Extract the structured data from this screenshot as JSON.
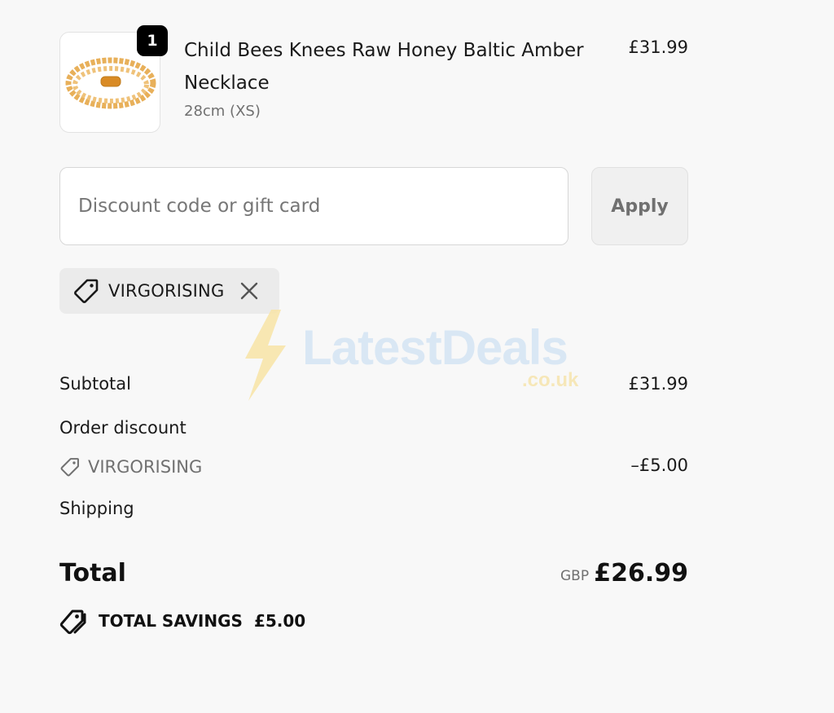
{
  "product": {
    "quantity": "1",
    "name": "Child Bees Knees Raw Honey Baltic Amber Necklace",
    "variant": "28cm (XS)",
    "price": "£31.99"
  },
  "discount": {
    "placeholder": "Discount code or gift card",
    "apply_label": "Apply",
    "applied_code": "VIRGORISING"
  },
  "watermark": {
    "main": "LatestDeals",
    "sub": ".co.uk"
  },
  "summary": {
    "subtotal_label": "Subtotal",
    "subtotal_value": "£31.99",
    "order_discount_label": "Order discount",
    "discount_code": "VIRGORISING",
    "discount_value": "–£5.00",
    "shipping_label": "Shipping",
    "total_label": "Total",
    "currency": "GBP",
    "total_value": "£26.99",
    "savings_label": "TOTAL SAVINGS",
    "savings_value": "£5.00"
  },
  "colors": {
    "accent_badge": "#000000",
    "muted_text": "#707070",
    "amber": "#e6a23c"
  },
  "icons": [
    "amber-necklace-image",
    "tag-icon",
    "close-icon",
    "bolt-icon",
    "tags-icon"
  ]
}
